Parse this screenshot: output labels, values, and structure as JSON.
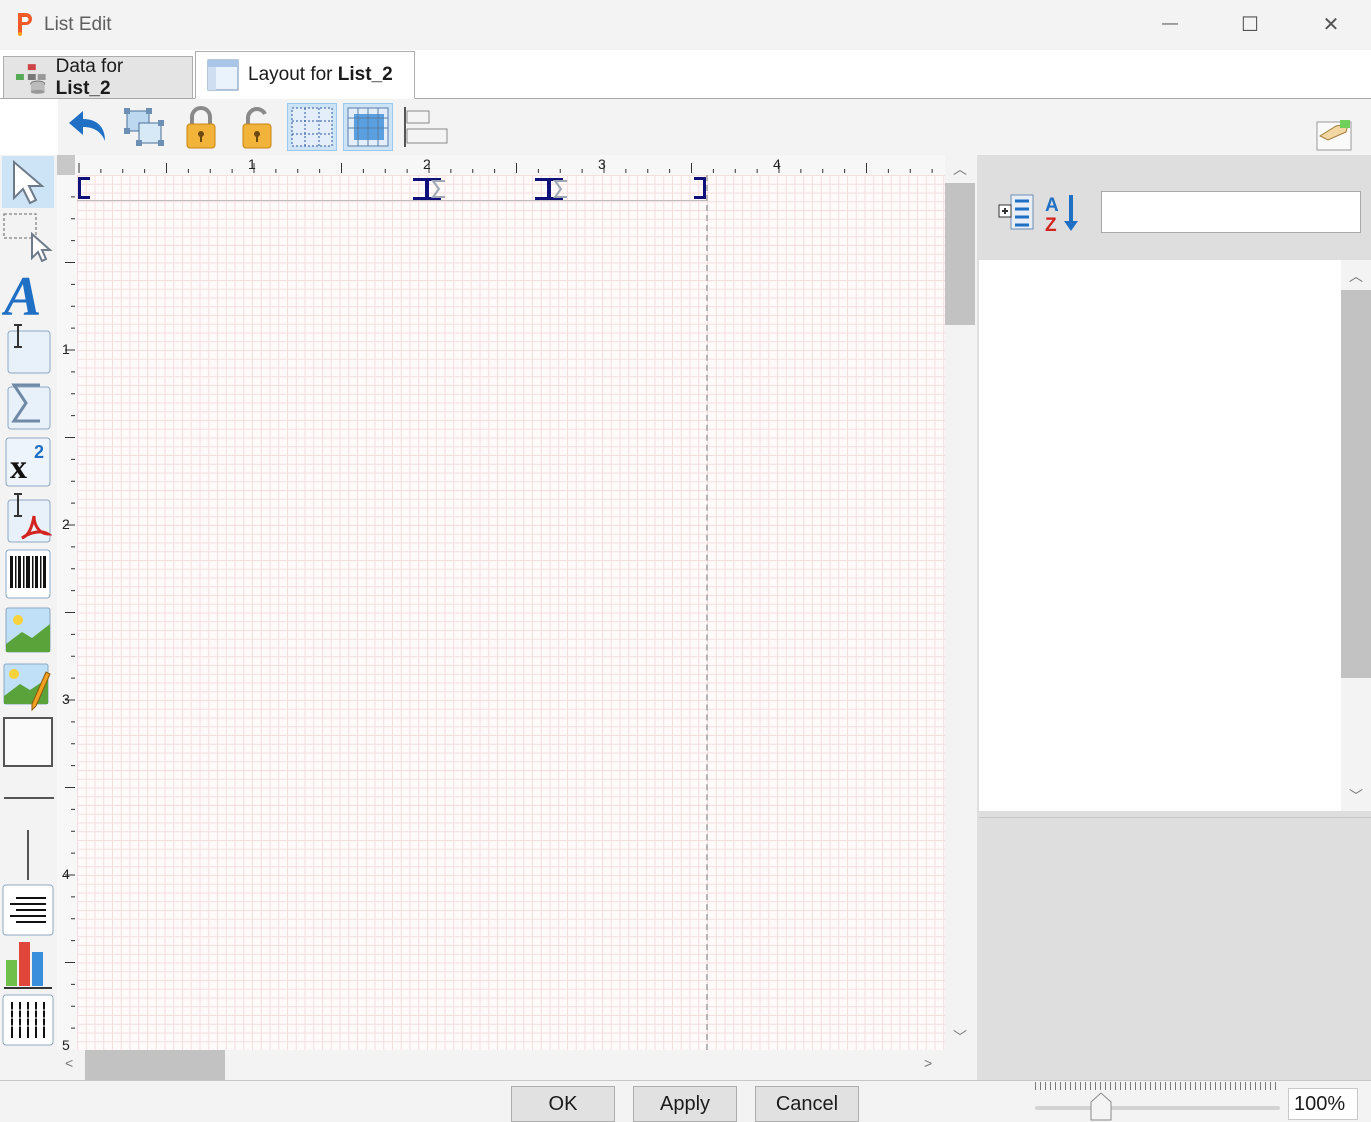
{
  "window": {
    "title": "List Edit",
    "minimize_glyph": "—",
    "maximize_glyph": "☐",
    "close_glyph": "✕"
  },
  "tabs": [
    {
      "prefix": "Data for ",
      "name": "List_2",
      "icon": "data-source-icon",
      "selected": false
    },
    {
      "prefix": "Layout for ",
      "name": "List_2",
      "icon": "layout-icon",
      "selected": true
    }
  ],
  "toolbar": {
    "items": [
      "undo-icon",
      "group-icon",
      "lock-icon",
      "unlock-icon",
      "show-grid-icon",
      "snap-to-grid-icon",
      "align-icon"
    ],
    "active": [
      "show-grid-icon",
      "snap-to-grid-icon"
    ],
    "right_item": "edit-image-icon"
  },
  "palette": {
    "tools": [
      "select-arrow-icon",
      "marquee-select-icon",
      "text-icon",
      "field-icon",
      "sum-field-icon",
      "formula-icon",
      "pdf-field-icon",
      "barcode-icon",
      "image-icon",
      "image-field-icon",
      "rectangle-icon",
      "horizontal-line-icon",
      "vertical-line-icon",
      "paragraph-icon",
      "chart-icon",
      "table-icon"
    ],
    "selected": "select-arrow-icon"
  },
  "rulers": {
    "horizontal": [
      "1",
      "2",
      "3",
      "4"
    ],
    "vertical": [
      "1",
      "2",
      "3",
      "4",
      "5"
    ]
  },
  "properties": {
    "search_value": "",
    "buttons": [
      "categorize-icon",
      "sort-az-icon"
    ]
  },
  "dialog": {
    "ok_label": "OK",
    "apply_label": "Apply",
    "cancel_label": "Cancel"
  },
  "zoom": {
    "value_text": "100%",
    "level": 0.27
  },
  "colors": {
    "accent": "#cde4f7",
    "canvas_grid": "#f3dede",
    "band_marker": "#10107a"
  }
}
